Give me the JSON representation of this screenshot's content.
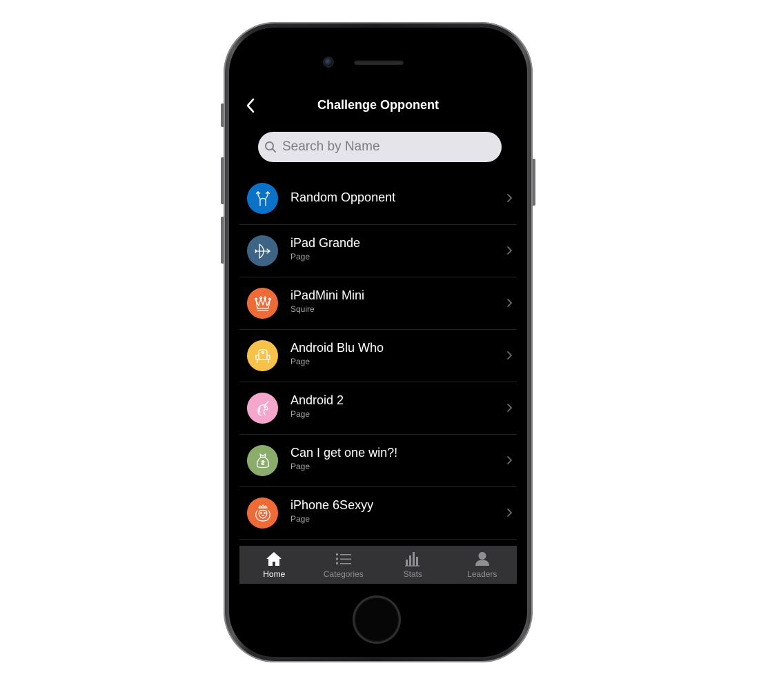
{
  "header": {
    "title": "Challenge Opponent"
  },
  "search": {
    "placeholder": "Search by Name"
  },
  "opponents": [
    {
      "name": "Random Opponent",
      "subtitle": "",
      "avatar_color": "#0a72c8",
      "icon": "swap-arrows-icon"
    },
    {
      "name": "iPad Grande",
      "subtitle": "Page",
      "avatar_color": "#3d6484",
      "icon": "bow-arrow-icon"
    },
    {
      "name": "iPadMini Mini",
      "subtitle": "Squire",
      "avatar_color": "#ee6a37",
      "icon": "crown-icon"
    },
    {
      "name": "Android Blu Who",
      "subtitle": "Page",
      "avatar_color": "#f6c24a",
      "icon": "throne-icon"
    },
    {
      "name": "Android 2",
      "subtitle": "Page",
      "avatar_color": "#f4a6cc",
      "icon": "unicorn-icon"
    },
    {
      "name": "Can I get one win?!",
      "subtitle": "Page",
      "avatar_color": "#8bad6c",
      "icon": "money-bag-icon"
    },
    {
      "name": "iPhone 6Sexyy",
      "subtitle": "Page",
      "avatar_color": "#ee6a37",
      "icon": "lion-icon"
    }
  ],
  "tabbar": {
    "items": [
      {
        "label": "Home",
        "icon": "home-icon",
        "active": true
      },
      {
        "label": "Categories",
        "icon": "list-icon",
        "active": false
      },
      {
        "label": "Stats",
        "icon": "bar-chart-icon",
        "active": false
      },
      {
        "label": "Leaders",
        "icon": "person-icon",
        "active": false
      }
    ]
  },
  "colors": {
    "background": "#000000",
    "search_bg": "#e4e4ea",
    "tabbar_bg": "#333335",
    "tab_inactive": "#8e8e93"
  }
}
